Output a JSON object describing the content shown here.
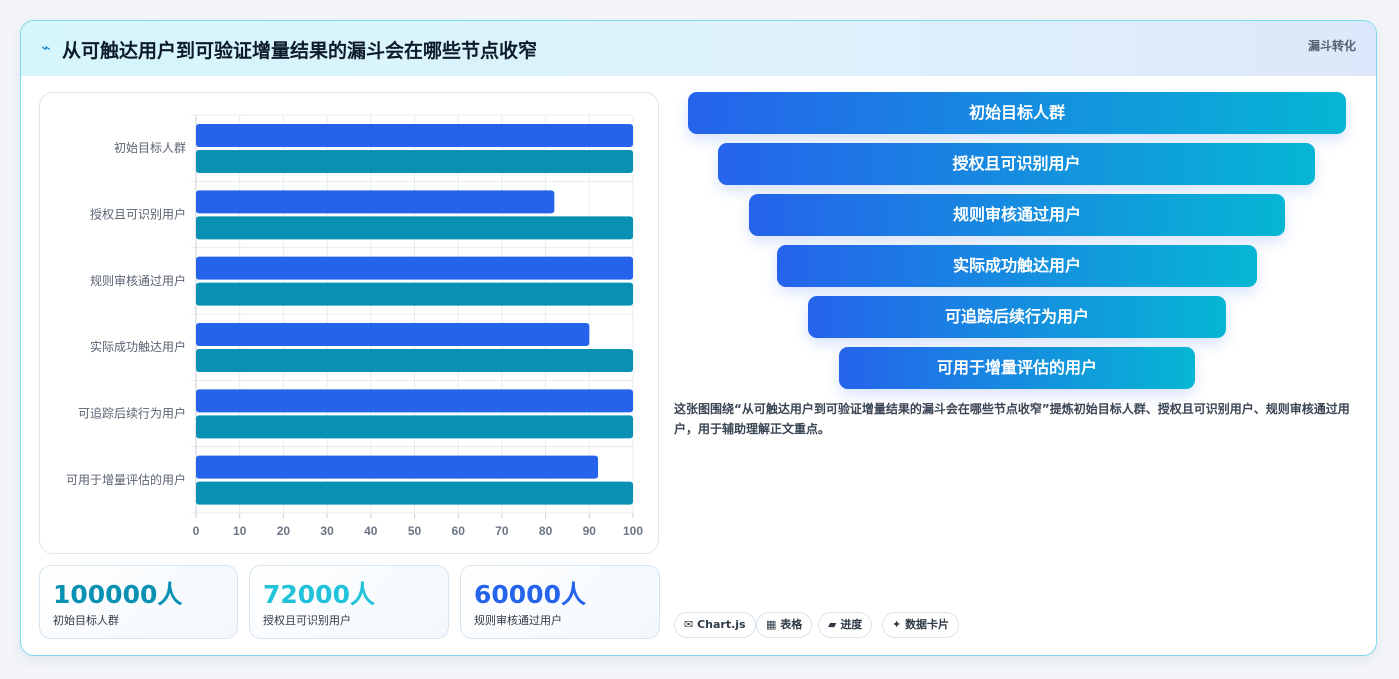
{
  "header": {
    "title": "从可触达用户到可验证增量结果的漏斗会在哪些节点收窄",
    "badge": "漏斗转化",
    "icon": "lightning-icon"
  },
  "chart_data": {
    "type": "bar",
    "orientation": "horizontal",
    "categories": [
      "初始目标人群",
      "授权且可识别用户",
      "规则审核通过用户",
      "实际成功触达用户",
      "可追踪后续行为用户",
      "可用于增量评估的用户"
    ],
    "series": [
      {
        "values": [
          100,
          82,
          100,
          90,
          100,
          92
        ],
        "color": "#2563eb"
      },
      {
        "values": [
          100,
          100,
          100,
          100,
          100,
          100
        ],
        "color": "#0891b2"
      }
    ],
    "xlim": [
      0,
      100
    ],
    "xticks": [
      0,
      10,
      20,
      30,
      40,
      50,
      60,
      70,
      80,
      90,
      100
    ],
    "grid": true
  },
  "stats": [
    {
      "value": "100000人",
      "label": "初始目标人群",
      "color": "#0891b2"
    },
    {
      "value": "72000人",
      "label": "授权且可识别用户",
      "color": "#22c3da"
    },
    {
      "value": "60000人",
      "label": "规则审核通过用户",
      "color": "#2563eb"
    }
  ],
  "funnel": [
    "初始目标人群",
    "授权且可识别用户",
    "规则审核通过用户",
    "实际成功触达用户",
    "可追踪后续行为用户",
    "可用于增量评估的用户"
  ],
  "description": "这张图围绕“从可触达用户到可验证增量结果的漏斗会在哪些节点收窄”提炼初始目标人群、授权且可识别用户、规则审核通过用户，用于辅助理解正文重点。",
  "chips": [
    {
      "icon": "✉",
      "label": "Chart.js"
    },
    {
      "icon": "▦",
      "label": "表格"
    },
    {
      "icon": "▰",
      "label": "进度"
    },
    {
      "icon": "✦",
      "label": "数据卡片"
    }
  ]
}
